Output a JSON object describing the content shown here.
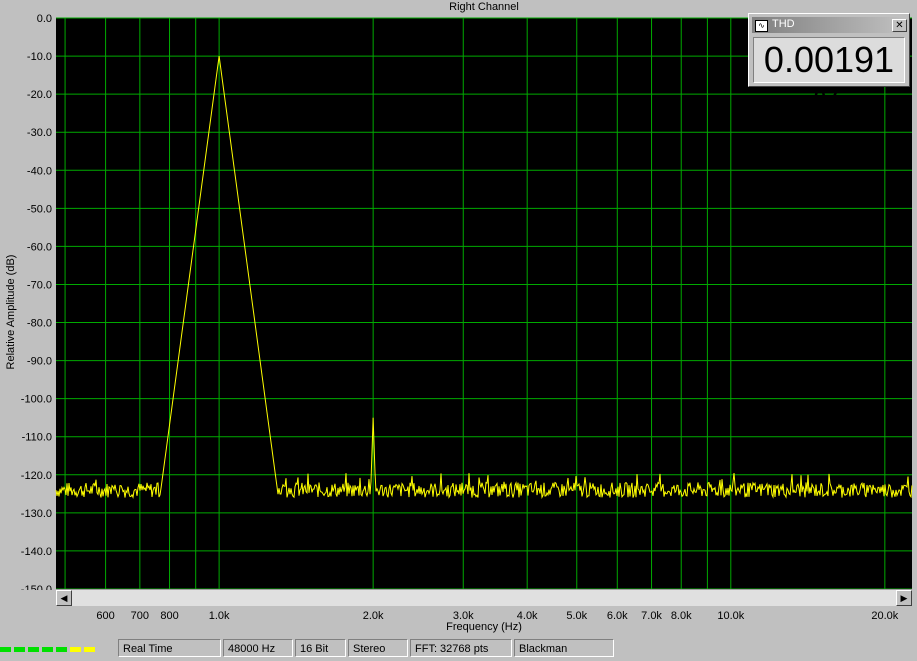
{
  "chart_data": {
    "type": "line",
    "title": "Right Channel",
    "xlabel": "Frequency (Hz)",
    "ylabel": "Relative Amplitude (dB)",
    "x_scale": "log",
    "xlim": [
      480,
      22600
    ],
    "ylim": [
      -150,
      0
    ],
    "yticks": [
      0,
      -10,
      -20,
      -30,
      -40,
      -50,
      -60,
      -70,
      -80,
      -90,
      -100,
      -110,
      -120,
      -130,
      -140,
      -150
    ],
    "ytick_labels": [
      "0.0",
      "-10.0",
      "-20.0",
      "-30.0",
      "-40.0",
      "-50.0",
      "-60.0",
      "-70.0",
      "-80.0",
      "-90.0",
      "-100.0",
      "-110.0",
      "-120.0",
      "-130.0",
      "-140.0",
      "-150.0"
    ],
    "xticks": [
      600,
      700,
      800,
      1000,
      2000,
      3000,
      4000,
      5000,
      6000,
      7000,
      8000,
      10000,
      20000
    ],
    "xtick_labels": [
      "600",
      "700",
      "800",
      "1.0k",
      "2.0k",
      "3.0k",
      "4.0k",
      "5.0k",
      "6.0k",
      "7.0k",
      "8.0k",
      "10.0k",
      "20.0k"
    ],
    "xgrid_lines": [
      500,
      600,
      700,
      800,
      900,
      1000,
      2000,
      3000,
      4000,
      5000,
      6000,
      7000,
      8000,
      9000,
      10000,
      20000
    ],
    "grid": true,
    "series": [
      {
        "color": "#ffff00",
        "noise_floor_db": -124,
        "peaks": [
          {
            "x": 1000,
            "y": -10
          },
          {
            "x": 2000,
            "y": -105
          }
        ]
      }
    ]
  },
  "thd_window": {
    "title": "THD",
    "value": "0.00191 %",
    "close_glyph": "✕",
    "icon": "waveform-icon"
  },
  "scrollbar": {
    "left_arrow": "◀",
    "right_arrow": "▶"
  },
  "status_bar": {
    "mode": "Real Time",
    "sample_rate": "48000 Hz",
    "bit_depth": "16 Bit",
    "channels": "Stereo",
    "fft": "FFT: 32768 pts",
    "window": "Blackman"
  },
  "colors": {
    "plot_bg": "#000000",
    "grid": "#00aa00",
    "trace": "#ffff00",
    "led_green": "#00e000",
    "led_yellow": "#ffff00"
  }
}
